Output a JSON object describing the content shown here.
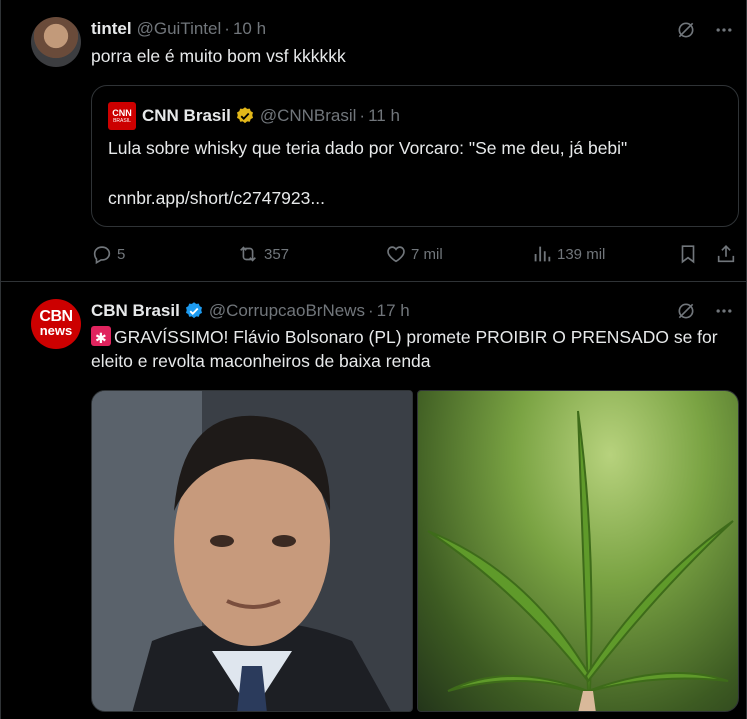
{
  "post1": {
    "author_name": "tintel",
    "author_handle": "@GuiTintel",
    "time": "10 h",
    "text": "porra ele é muito bom vsf kkkkkk",
    "quote": {
      "author_name": "CNN Brasil",
      "author_handle": "@CNNBrasil",
      "time": "11 h",
      "avatar_text": "CNN",
      "avatar_sub": "BRASIL",
      "text": "Lula sobre whisky que teria dado por Vorcaro: \"Se me deu, já bebi\"",
      "link": "cnnbr.app/short/c2747923..."
    },
    "actions": {
      "replies": "5",
      "reposts": "357",
      "likes": "7 mil",
      "views": "139 mil"
    }
  },
  "post2": {
    "author_name": "CBN Brasil",
    "author_handle": "@CorrupcaoBrNews",
    "time": "17 h",
    "avatar_line1": "CBN",
    "avatar_line2": "news",
    "text": "GRAVÍSSIMO! Flávio Bolsonaro (PL) promete PROIBIR O PRENSADO se for eleito e revolta maconheiros de baixa renda"
  },
  "colors": {
    "background": "#000000",
    "text": "#e7e9ea",
    "muted": "#71767b",
    "border": "#2f3336",
    "verified_gold": "#e2b719",
    "verified_blue": "#1d9bf0",
    "brand_red": "#cc0000"
  },
  "icons": [
    "grok-icon",
    "more-icon",
    "reply-icon",
    "repost-icon",
    "like-icon",
    "views-icon",
    "bookmark-icon",
    "share-icon",
    "verified-icon",
    "siren-emoji"
  ]
}
